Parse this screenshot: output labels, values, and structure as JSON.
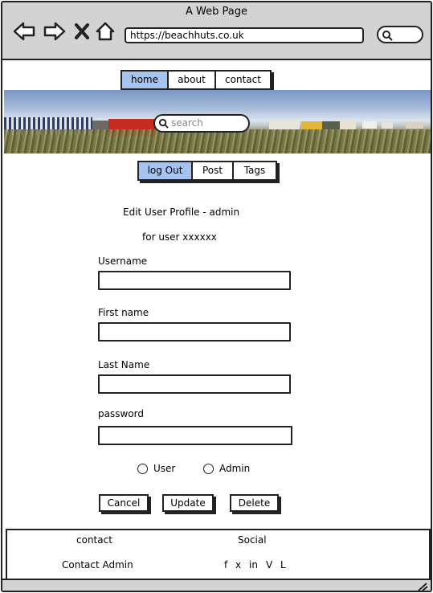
{
  "browser": {
    "window_title": "A Web Page",
    "url": "https://beachhuts.co.uk"
  },
  "site_nav": {
    "items": [
      "home",
      "about",
      "contact"
    ],
    "active": "home"
  },
  "hero": {
    "search_placeholder": "search"
  },
  "user_nav": {
    "items": [
      "log Out",
      "Post",
      "Tags"
    ],
    "active": "log Out"
  },
  "form": {
    "title": "Edit User Profile - admin",
    "subtitle": "for user xxxxxx",
    "username_label": "Username",
    "firstname_label": "First name",
    "lastname_label": "Last Name",
    "password_label": "password",
    "role_options": [
      "User",
      "Admin"
    ],
    "cancel_label": "Cancel",
    "update_label": "Update",
    "delete_label": "Delete"
  },
  "footer": {
    "contact_heading": "contact",
    "social_heading": "Social",
    "contact_admin": "Contact Admin",
    "social_links": [
      "f",
      "x",
      "in",
      "V",
      "L"
    ]
  },
  "colors": {
    "active_tab": "#a6c2ee",
    "chrome": "#d3d3d3"
  }
}
